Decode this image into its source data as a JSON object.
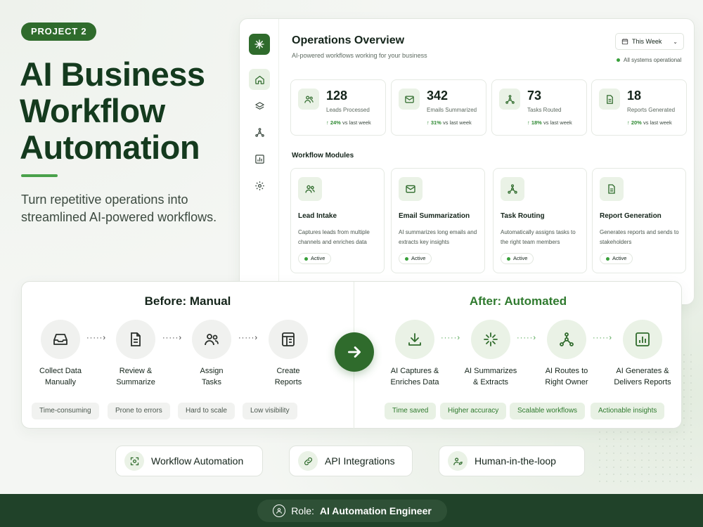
{
  "hero": {
    "badge": "PROJECT 2",
    "title_lines": [
      "AI Business",
      "Workflow",
      "Automation"
    ],
    "subtitle": "Turn repetitive operations into streamlined AI-powered workflows."
  },
  "dashboard": {
    "title": "Operations Overview",
    "subtitle": "AI-powered workflows working for your business",
    "period_select": "This Week",
    "status": "All systems operational",
    "sidebar_icons": [
      "sparkle-logo-icon",
      "home-icon",
      "layers-icon",
      "network-icon",
      "bar-chart-icon",
      "gear-icon"
    ],
    "stats": [
      {
        "value": "128",
        "label": "Leads Processed",
        "change": "24%",
        "suffix": "vs last week",
        "icon": "users-icon"
      },
      {
        "value": "342",
        "label": "Emails Summarized",
        "change": "31%",
        "suffix": "vs last week",
        "icon": "mail-icon"
      },
      {
        "value": "73",
        "label": "Tasks Routed",
        "change": "18%",
        "suffix": "vs last week",
        "icon": "network-icon"
      },
      {
        "value": "18",
        "label": "Reports Generated",
        "change": "20%",
        "suffix": "vs last week",
        "icon": "document-icon"
      }
    ],
    "modules_heading": "Workflow Modules",
    "modules": [
      {
        "title": "Lead Intake",
        "desc": "Captures leads from multiple channels and enriches data",
        "status": "Active",
        "icon": "users-icon"
      },
      {
        "title": "Email Summarization",
        "desc": "AI summarizes long emails and extracts key insights",
        "status": "Active",
        "icon": "mail-icon"
      },
      {
        "title": "Task Routing",
        "desc": "Automatically assigns tasks to the right team members",
        "status": "Active",
        "icon": "network-icon"
      },
      {
        "title": "Report Generation",
        "desc": "Generates reports and sends to stakeholders",
        "status": "Active",
        "icon": "document-icon"
      }
    ]
  },
  "comparison": {
    "before_title": "Before: Manual",
    "after_title": "After: Automated",
    "before_steps": [
      {
        "line1": "Collect Data",
        "line2": "Manually",
        "icon": "inbox-icon"
      },
      {
        "line1": "Review &",
        "line2": "Summarize",
        "icon": "document-icon"
      },
      {
        "line1": "Assign",
        "line2": "Tasks",
        "icon": "users-icon"
      },
      {
        "line1": "Create",
        "line2": "Reports",
        "icon": "table-icon"
      }
    ],
    "after_steps": [
      {
        "line1": "AI Captures &",
        "line2": "Enriches Data",
        "icon": "download-icon"
      },
      {
        "line1": "AI Summarizes",
        "line2": "& Extracts",
        "icon": "sparkle-icon"
      },
      {
        "line1": "AI Routes to",
        "line2": "Right Owner",
        "icon": "network-icon"
      },
      {
        "line1": "AI Generates &",
        "line2": "Delivers Reports",
        "icon": "bar-chart-icon"
      }
    ],
    "before_tags": [
      "Time-consuming",
      "Prone to errors",
      "Hard to scale",
      "Low visibility"
    ],
    "after_tags": [
      "Time saved",
      "Higher accuracy",
      "Scalable workflows",
      "Actionable insights"
    ]
  },
  "capabilities": [
    {
      "label": "Workflow Automation",
      "icon": "focus-icon"
    },
    {
      "label": "API Integrations",
      "icon": "link-icon"
    },
    {
      "label": "Human-in-the-loop",
      "icon": "user-leaf-icon"
    }
  ],
  "footer": {
    "role_prefix": "Role:",
    "role_value": "AI Automation Engineer"
  },
  "colors": {
    "brand_green": "#2f6b2c",
    "accent_green": "#49a14a",
    "footer_bg": "#204229",
    "text_dark": "#14241a"
  }
}
